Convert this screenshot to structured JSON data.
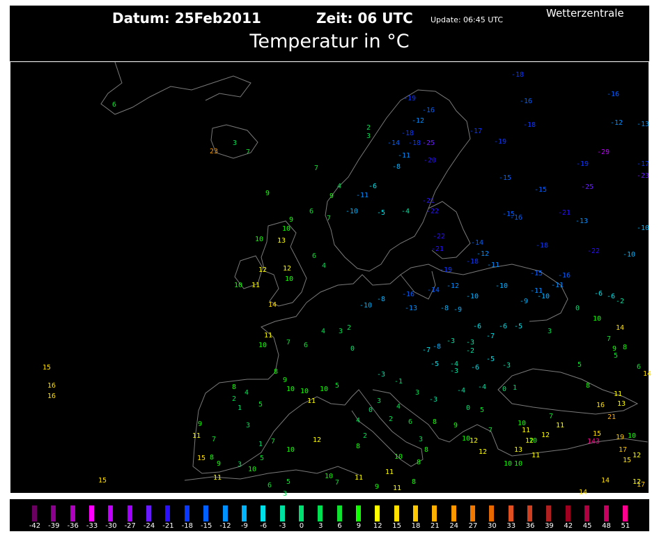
{
  "header": {
    "date": "Datum: 25Feb2011",
    "time": "Zeit: 06  UTC",
    "update": "Update: 06:45 UTC",
    "brand": "Wetterzentrale",
    "title": "Temperatur in °C"
  },
  "legend": {
    "values": [
      -42,
      -39,
      -36,
      -33,
      -30,
      -27,
      -24,
      -21,
      -18,
      -15,
      -12,
      -9,
      -6,
      -3,
      0,
      3,
      6,
      9,
      12,
      15,
      18,
      21,
      24,
      27,
      30,
      33,
      36,
      39,
      42,
      45,
      48,
      51
    ],
    "colors": [
      "#6a0060",
      "#8c0090",
      "#b000c0",
      "#ff00ff",
      "#c000ff",
      "#a000ff",
      "#6a1aff",
      "#2a10ff",
      "#0a38ff",
      "#0060ff",
      "#0090ff",
      "#00b4ff",
      "#00e0e8",
      "#00e0a0",
      "#00e070",
      "#00e050",
      "#10e030",
      "#10ff00",
      "#ffff00",
      "#ffe000",
      "#ffc800",
      "#ffb000",
      "#ff9800",
      "#f07800",
      "#e86800",
      "#e05020",
      "#d04020",
      "#b02020",
      "#a00020",
      "#b00040",
      "#c80060",
      "#ff0090"
    ]
  },
  "stations": [
    6,
    23,
    3,
    7,
    7,
    9,
    15,
    16,
    16,
    15,
    10,
    9,
    13,
    10,
    12,
    10,
    11,
    14,
    12,
    10,
    6,
    4,
    6,
    7,
    9,
    4,
    -10,
    -11,
    -5,
    -4,
    -6,
    -8,
    -11,
    -14,
    -18,
    -25,
    -18,
    -12,
    -16,
    -19,
    2,
    3,
    -20,
    -22,
    -21,
    -19,
    -22,
    -21,
    -18,
    -16,
    -16,
    -18,
    -19,
    -17,
    -12,
    -13,
    -29,
    -19,
    -17,
    -23,
    -15,
    -15,
    -25,
    -21,
    -13,
    -16,
    -15,
    -10,
    -18,
    -22,
    -10,
    -14,
    -12,
    -18,
    -11,
    -15,
    -16,
    -11,
    -10,
    -10,
    -12,
    -14,
    -16,
    -13,
    -8,
    -9,
    -11,
    -10,
    -9,
    -6,
    -6,
    -2,
    0,
    -6,
    -6,
    -5,
    -7,
    -3,
    -2,
    -5,
    -6,
    -3,
    -4,
    -5,
    -7,
    -8,
    -3,
    -10,
    -8,
    2,
    0,
    3,
    4,
    6,
    7,
    11,
    10,
    8,
    9,
    10,
    10,
    11,
    8,
    4,
    2,
    1,
    5,
    3,
    9,
    11,
    7,
    1,
    7,
    10,
    12,
    5,
    3,
    10,
    15,
    8,
    9,
    11,
    6,
    5,
    3,
    10,
    7,
    11,
    9,
    11,
    8,
    8,
    10,
    11,
    4,
    2,
    8,
    3,
    0,
    2,
    4,
    6,
    8,
    3,
    8,
    9,
    10,
    12,
    12,
    7,
    10,
    11,
    10,
    12,
    13,
    11,
    10,
    10,
    12,
    11,
    7,
    8,
    5,
    5,
    6,
    14,
    11,
    13,
    16,
    21,
    15,
    143,
    19,
    10,
    17,
    12,
    15,
    14,
    14,
    12,
    17,
    9,
    8,
    7,
    14,
    10,
    3,
    5,
    0,
    -4,
    -4,
    -3,
    0,
    1,
    -3,
    3,
    -1,
    -3,
    5,
    10
  ]
}
